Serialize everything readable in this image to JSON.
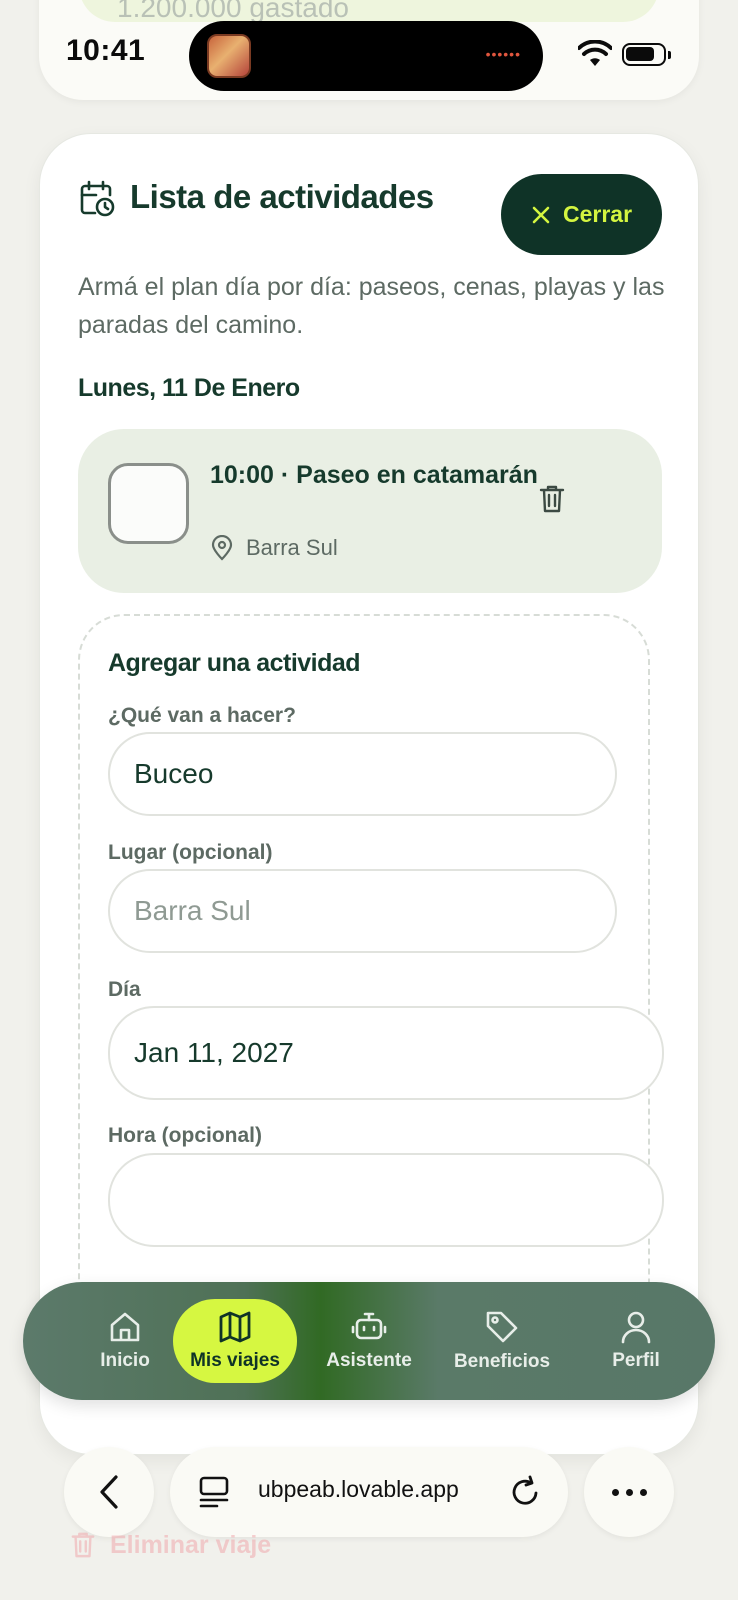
{
  "status_bar": {
    "time": "10:41"
  },
  "background": {
    "prev_card_text": "1.200.000 gastado"
  },
  "sheet": {
    "title": "Lista de actividades",
    "close_label": "Cerrar",
    "description": "Armá el plan día por día: paseos, cenas, playas y las paradas del camino.",
    "day_heading": "Lunes, 11 De Enero",
    "activities": [
      {
        "title": "10:00 · Paseo en catamarán",
        "place": "Barra Sul",
        "done": false
      }
    ],
    "add_form": {
      "title": "Agregar una actividad",
      "what_label": "¿Qué van a hacer?",
      "what_value": "Buceo",
      "place_label": "Lugar (opcional)",
      "place_placeholder": "Barra Sul",
      "day_label": "Día",
      "day_value": "Jan 11, 2027",
      "time_label": "Hora (opcional)",
      "time_value": ""
    }
  },
  "bottom_nav": {
    "items": [
      {
        "label": "Inicio",
        "icon": "home-icon",
        "active": false
      },
      {
        "label": "Mis viajes",
        "icon": "map-icon",
        "active": true
      },
      {
        "label": "Asistente",
        "icon": "bot-icon",
        "active": false
      },
      {
        "label": "Beneficios",
        "icon": "tag-icon",
        "active": false
      },
      {
        "label": "Perfil",
        "icon": "user-icon",
        "active": false
      }
    ]
  },
  "browser": {
    "url": "ubpeab.lovable.app"
  },
  "footer": {
    "delete_trip_label": "Eliminar viaje"
  },
  "colors": {
    "brand_dark": "#0f3327",
    "accent_lime": "#d6f741",
    "text_primary": "#163a2c",
    "text_muted": "#5d6a63",
    "activity_bg": "#e9efe4",
    "danger_faded": "#f09aa0"
  }
}
